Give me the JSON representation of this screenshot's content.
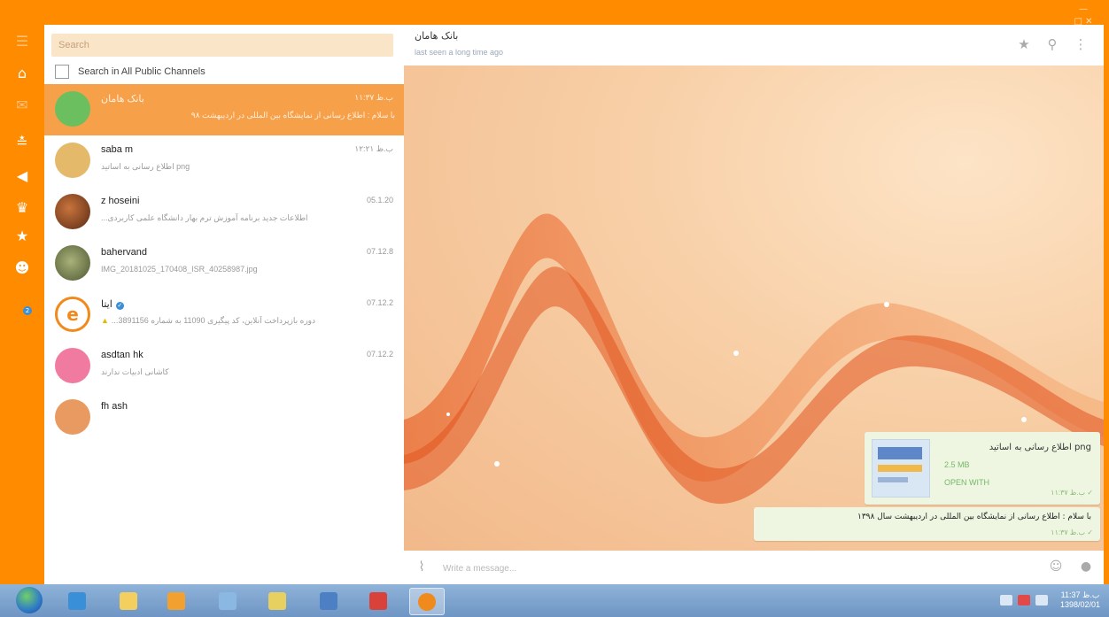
{
  "window": {
    "controls_label": "— □ ✕"
  },
  "rail": {
    "icons": [
      "menu-icon",
      "home-icon",
      "unread-icon",
      "groups-icon",
      "channels-icon",
      "crown-icon",
      "favorites-icon",
      "bot-icon"
    ],
    "badge": "2"
  },
  "sidebar": {
    "search_placeholder": "Search",
    "public_label": "Search in All Public Channels",
    "chats": [
      {
        "name": "بانک هامان",
        "time": "۱۱:۳۷ ب.ظ",
        "preview": "با سلام : اطلاع رسانی از نمایشگاه بین المللی در اردیبهشت ۹۸",
        "avatar_color": "#6cbf5f",
        "active": true
      },
      {
        "name": "saba m",
        "time": "۱۲:۲۱ ب.ظ",
        "preview": "png اطلاع رسانی به اساتید",
        "avatar_color": "#e5b96a"
      },
      {
        "name": "z hoseini",
        "time": "05.1.20",
        "preview": "...اطلاعات جدید برنامه آموزش ترم بهار دانشگاه علمی کاربردی",
        "avatar_color": "#8a4a2a"
      },
      {
        "name": "bahervand",
        "time": "07.12.8",
        "preview": "IMG_20181025_170408_ISR_40258987.jpg",
        "avatar_color": "#5b6a3e"
      },
      {
        "name": "ایتا",
        "time": "07.12.2",
        "preview": "...دوره بازپرداخت آنلاین، کد پیگیری 11090 به شماره 3891156",
        "avatar_color": "#f08a1c",
        "verified": true,
        "warning": true
      },
      {
        "name": "asdtan hk",
        "time": "07.12.2",
        "preview": "کاشانی ادبیات ندارند",
        "avatar_color": "#f07aa0"
      },
      {
        "name": "fh ash",
        "time": "",
        "preview": "",
        "avatar_color": "#e89a60"
      }
    ]
  },
  "header": {
    "title": "بانک هامان",
    "status": "last seen a long time ago"
  },
  "messages": {
    "file": {
      "name": "png اطلاع رسانی به اساتید",
      "size": "2.5 MB",
      "action": "OPEN WITH",
      "time": "۱۱:۳۷ ب.ظ ✓"
    },
    "text": {
      "body": "با سلام : اطلاع رسانی از نمایشگاه بین المللی در اردیبهشت سال ۱۳۹۸",
      "time": "۱۱:۳۷ ب.ظ ✓"
    }
  },
  "composer": {
    "placeholder": "Write a message..."
  },
  "taskbar": {
    "apps": [
      "windows-start",
      "internet-explorer",
      "windows-explorer",
      "media-player",
      "search-app",
      "notes-app",
      "display-app",
      "calendar-app",
      "eita-app"
    ],
    "clock_time": "11:37 ب.ظ",
    "clock_date": "1398/02/01"
  },
  "colors": {
    "accent": "#ff8c00",
    "active_chat": "#f6a04a",
    "bubble": "#eef6e1"
  }
}
